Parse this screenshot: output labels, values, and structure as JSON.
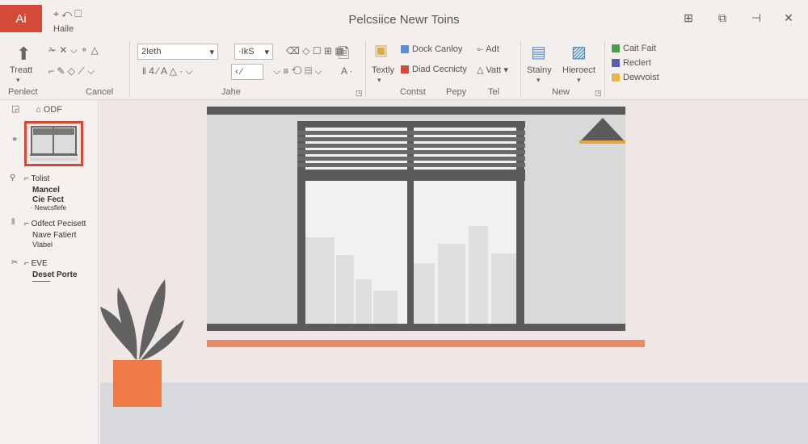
{
  "app": {
    "badge": "Ai",
    "quick_access": "⌖ ↶ ☐",
    "quick_access_label": "Haile"
  },
  "window": {
    "title": "Pelcsiice Newr Toins",
    "controls": [
      "⊞",
      "⧉",
      "⊣",
      "✕"
    ]
  },
  "ribbon": {
    "font_name": "2Ieth",
    "font_size": "·IkS",
    "groups": [
      "Penlect",
      "Cancel",
      "Jahe",
      "Contst",
      "Pepy",
      "Tel",
      "New"
    ],
    "treatt_label": "Treatt",
    "textly_label": "Textly",
    "dock_label": "Dock Canloy",
    "dad_label": "Diad Cecnicty",
    "adt_label": "Adt",
    "vatt_label": "Vatt",
    "stainy_label": "Stainy",
    "hieroect_label": "Hieroect",
    "cait_label": "Cait Fait",
    "reclert_label": "Reclert",
    "dewvoist_label": "Dewvoist",
    "accent_colors": {
      "cait": "#4c9a4c",
      "reclert": "#5a5fb0",
      "dewvoist": "#e8b64a"
    }
  },
  "panel": {
    "header": "ODF",
    "slide2": {
      "l1": "Tolist",
      "l2": "Mancel",
      "l3": "Cie Fect",
      "l4": "· Newcsflefe"
    },
    "slide3": {
      "l1": "Odfect Pecisett",
      "l2": "Nave Fatiert",
      "l3": "Vlabel"
    },
    "slide4": {
      "l1": "EVE",
      "l2": "Deset Porte"
    }
  },
  "colors": {
    "accent": "#d24a38",
    "plant_pot": "#ef7a48",
    "shelf": "#ec8a67",
    "frame": "#5b5b5b"
  }
}
